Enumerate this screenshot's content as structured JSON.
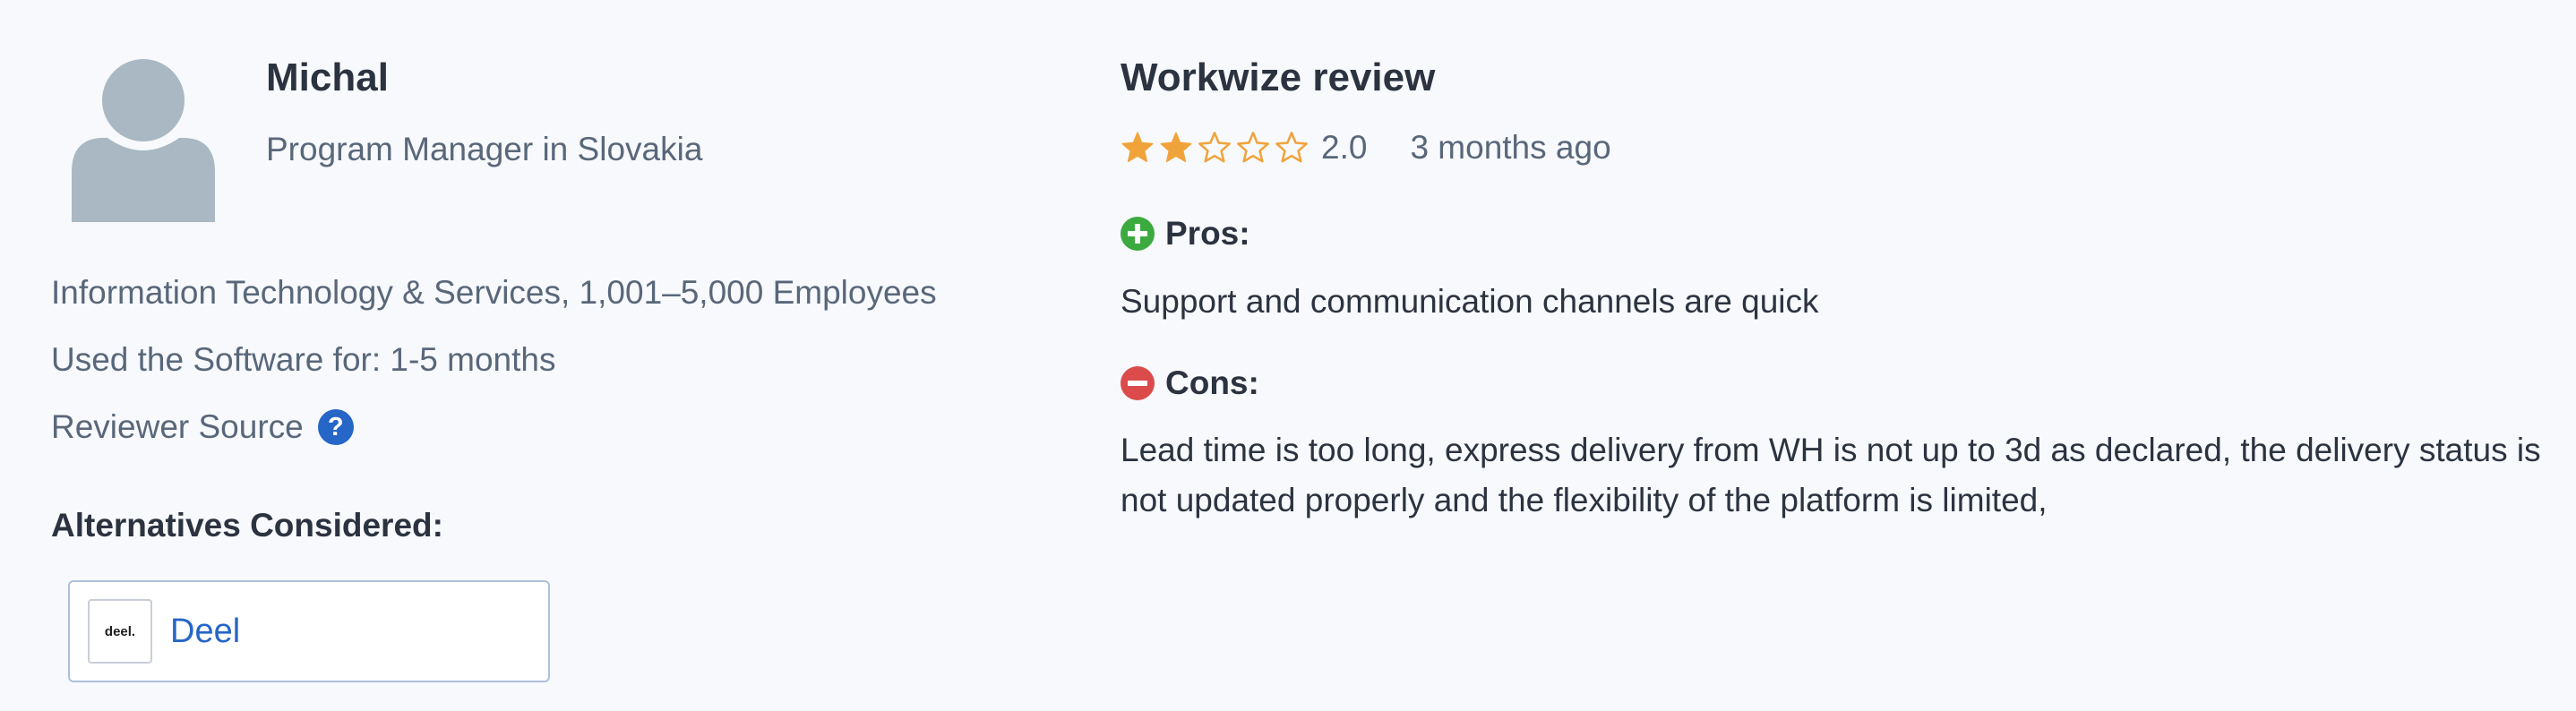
{
  "reviewer": {
    "name": "Michal",
    "role": "Program Manager in Slovakia",
    "industry_size": "Information Technology & Services, 1,001–5,000 Employees",
    "usage": "Used the Software for: 1-5 months",
    "source_label": "Reviewer Source",
    "source_help_glyph": "?"
  },
  "alternatives": {
    "heading": "Alternatives Considered:",
    "items": [
      {
        "logo_text": "deel.",
        "name": "Deel"
      }
    ]
  },
  "review": {
    "title": "Workwize review",
    "rating": 2.0,
    "rating_text": "2.0",
    "max_stars": 5,
    "date": "3 months ago",
    "pros_label": "Pros:",
    "pros_text": "Support and communication channels are quick",
    "cons_label": "Cons:",
    "cons_text": "Lead time is too long, express delivery from WH is not up to 3d as declared, the delivery status is not updated properly and the flexibility of the platform is limited,"
  },
  "icons": {
    "avatar": "user-silhouette-icon",
    "help": "question-circle-icon",
    "star": "star-icon",
    "pros": "plus-circle-icon",
    "cons": "minus-circle-icon"
  },
  "colors": {
    "star_filled": "#f1a33b",
    "star_empty_stroke": "#f1a33b",
    "pros_green": "#3bab3f",
    "cons_red": "#dc4b4b",
    "link_blue": "#2566c7",
    "avatar_gray": "#a9b8c3",
    "background": "#f7f9fc"
  }
}
